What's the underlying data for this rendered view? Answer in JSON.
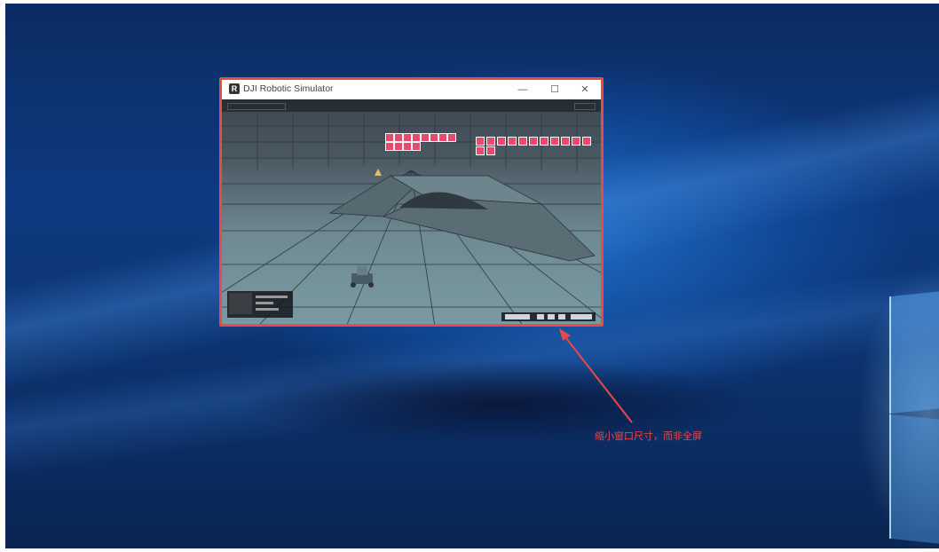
{
  "window": {
    "title": "DJI Robotic Simulator",
    "app_icon": "R",
    "controls": {
      "minimize": "—",
      "maximize": "☐",
      "close": "✕"
    }
  },
  "annotation": {
    "text": "缩小窗口尺寸，而非全屏"
  },
  "colors": {
    "highlight_border": "#e84a4a",
    "annotation_text": "#e84a4a",
    "desktop_blue": "#0e3a80"
  },
  "icons": [
    "app-logo-icon",
    "minimize-icon",
    "maximize-icon",
    "close-icon",
    "arrow-icon"
  ]
}
